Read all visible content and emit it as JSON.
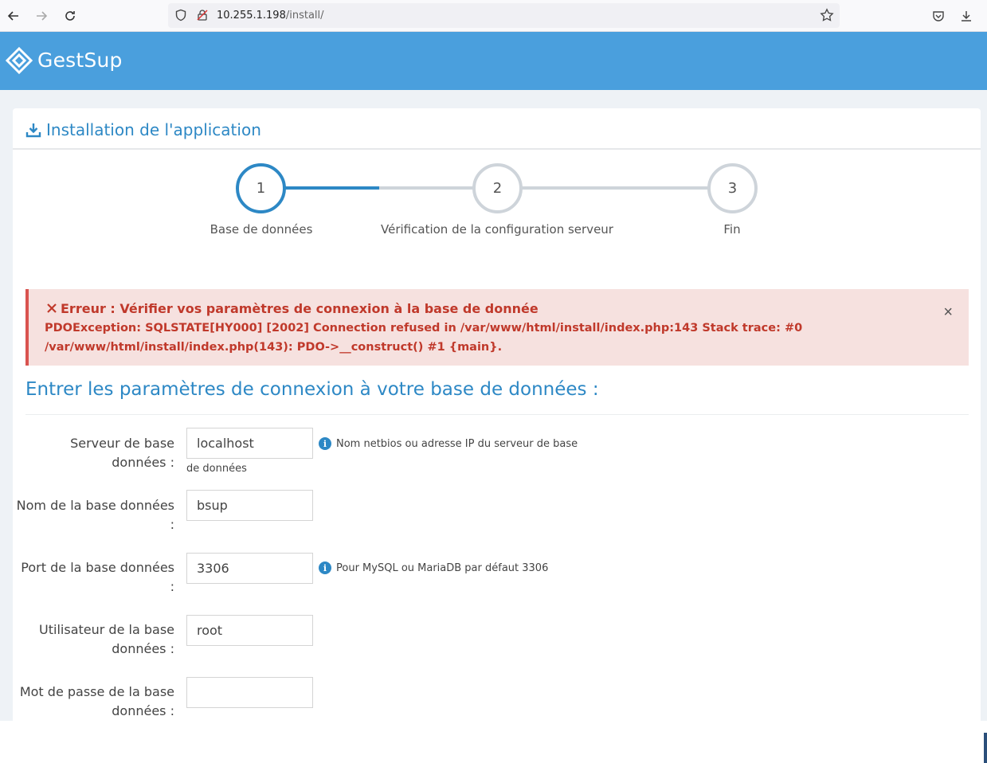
{
  "browser": {
    "url_host": "10.255.1.198",
    "url_path": "/install/"
  },
  "header": {
    "app_name": "GestSup"
  },
  "panel": {
    "title": "Installation de l'application"
  },
  "stepper": {
    "steps": [
      {
        "number": "1",
        "label": "Base de données"
      },
      {
        "number": "2",
        "label": "Vérification de la configuration serveur"
      },
      {
        "number": "3",
        "label": "Fin"
      }
    ]
  },
  "alert": {
    "title": "Erreur : Vérifier vos paramètres de connexion à la base de donnée",
    "message": "PDOException: SQLSTATE[HY000] [2002] Connection refused in /var/www/html/install/index.php:143 Stack trace: #0 /var/www/html/install/index.php(143): PDO->__construct() #1 {main}.",
    "close": "×"
  },
  "form": {
    "title": "Entrer les paramètres de connexion à votre base de données :",
    "fields": [
      {
        "label": "Serveur de base données :",
        "value": "localhost",
        "help": "Nom netbios ou adresse IP du serveur de base",
        "help_cont": "de données"
      },
      {
        "label": "Nom de la base données :",
        "value": "bsup"
      },
      {
        "label": "Port de la base données :",
        "value": "3306",
        "help": "Pour MySQL ou MariaDB par défaut 3306"
      },
      {
        "label": "Utilisateur de la base données :",
        "value": "root"
      },
      {
        "label": "Mot de passe de la base données :",
        "value": ""
      }
    ]
  },
  "colors": {
    "header": "#4a9fdd",
    "accent": "#2d88c5",
    "error": "#c0392b",
    "error_bg": "#f6e1df"
  }
}
